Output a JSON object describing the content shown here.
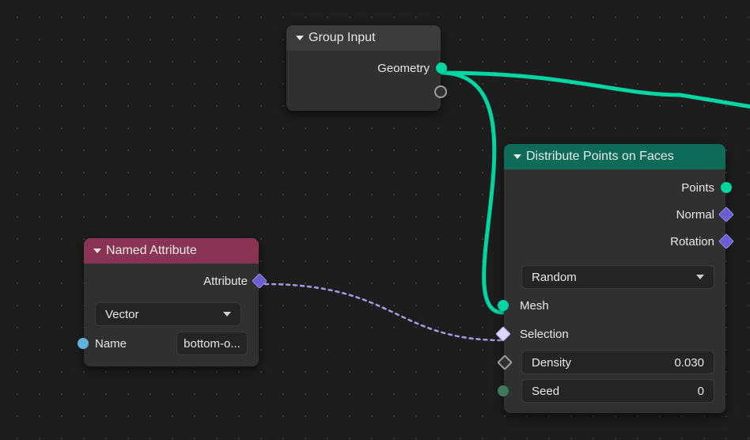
{
  "nodes": {
    "group_input": {
      "title": "Group Input",
      "outputs": {
        "geometry": "Geometry"
      }
    },
    "named_attribute": {
      "title": "Named Attribute",
      "outputs": {
        "attribute": "Attribute"
      },
      "type_select": "Vector",
      "name_label": "Name",
      "name_value": "bottom-o..."
    },
    "distribute": {
      "title": "Distribute Points on Faces",
      "outputs": {
        "points": "Points",
        "normal": "Normal",
        "rotation": "Rotation"
      },
      "mode": "Random",
      "inputs": {
        "mesh": "Mesh",
        "selection": "Selection",
        "density_label": "Density",
        "density_value": "0.030",
        "seed_label": "Seed",
        "seed_value": "0"
      }
    }
  }
}
